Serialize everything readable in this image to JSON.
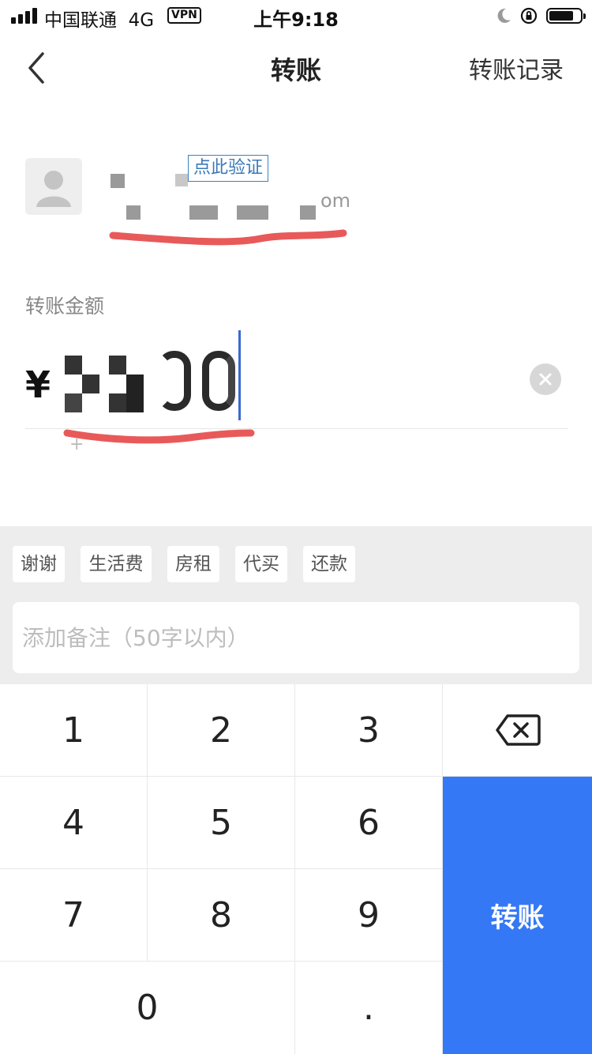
{
  "status_bar": {
    "carrier": "中国联通",
    "network": "4G",
    "vpn": "VPN",
    "time": "上午9:18"
  },
  "nav": {
    "title": "转账",
    "right_action": "转账记录"
  },
  "recipient": {
    "verify_label": "点此验证",
    "account_suffix": "om"
  },
  "amount": {
    "label": "转账金额",
    "currency_symbol": "¥",
    "plus_hint": "+"
  },
  "quick_remarks": [
    "谢谢",
    "生活费",
    "房租",
    "代买",
    "还款"
  ],
  "remark_placeholder": "添加备注（50字以内）",
  "keypad": {
    "digits": [
      "1",
      "2",
      "3",
      "4",
      "5",
      "6",
      "7",
      "8",
      "9",
      "0",
      "."
    ],
    "submit_label": "转账"
  },
  "colors": {
    "accent": "#3478f6",
    "verify": "#3b78b8",
    "annotation": "#e85a5a"
  },
  "icons": [
    "cellular-signal-icon",
    "moon-icon",
    "orientation-lock-icon",
    "battery-icon",
    "back-chevron-icon",
    "avatar-placeholder-icon",
    "clear-icon",
    "backspace-icon"
  ]
}
